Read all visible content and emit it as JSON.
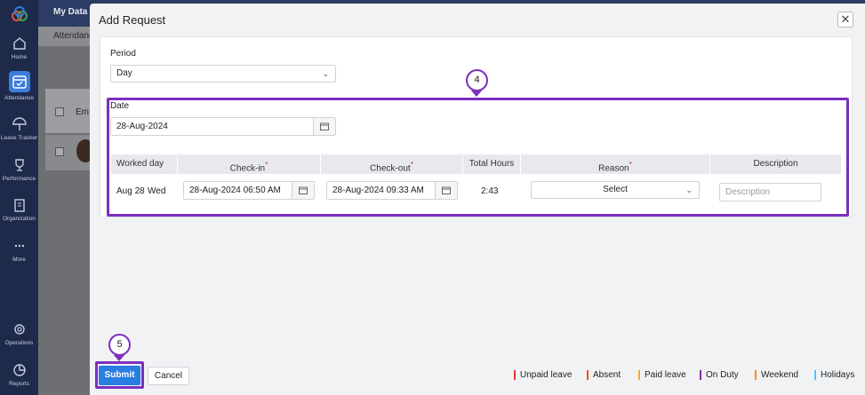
{
  "sidebar": {
    "items": [
      {
        "label": "Home",
        "icon": "home-icon"
      },
      {
        "label": "Attendance",
        "icon": "calendar-icon"
      },
      {
        "label": "Leave Tracker",
        "icon": "umbrella-icon"
      },
      {
        "label": "Performance",
        "icon": "trophy-icon"
      },
      {
        "label": "Organization",
        "icon": "building-icon"
      },
      {
        "label": "More",
        "icon": "more-dots-icon"
      },
      {
        "label": "Operations",
        "icon": "operations-icon"
      },
      {
        "label": "Reports",
        "icon": "pie-chart-icon"
      }
    ]
  },
  "background": {
    "title": "My Data",
    "tab": "Attendanc",
    "column": "Em"
  },
  "modal": {
    "title": "Add Request",
    "period_label": "Period",
    "period_value": "Day",
    "date_label": "Date",
    "date_value": "28-Aug-2024",
    "columns": {
      "worked_day": "Worked day",
      "check_in": "Check-in",
      "check_out": "Check-out",
      "total_hours": "Total Hours",
      "reason": "Reason",
      "description": "Description"
    },
    "row": {
      "day": "Aug 28",
      "weekday": "Wed",
      "check_in": "28-Aug-2024 06:50 AM",
      "check_out": "28-Aug-2024 09:33 AM",
      "total_hours": "2:43",
      "reason_placeholder": "Select",
      "description_placeholder": "Description"
    },
    "submit_label": "Submit",
    "cancel_label": "Cancel",
    "legend": [
      {
        "label": "Unpaid leave",
        "color": "#e53935"
      },
      {
        "label": "Absent",
        "color": "#f4511e"
      },
      {
        "label": "Paid leave",
        "color": "#f9a825"
      },
      {
        "label": "On Duty",
        "color": "#8e24aa"
      },
      {
        "label": "Weekend",
        "color": "#fb8c00"
      },
      {
        "label": "Holidays",
        "color": "#4fc3f7"
      }
    ]
  },
  "annotations": {
    "step_4": "4",
    "step_5": "5",
    "color": "#7b2fbf"
  }
}
